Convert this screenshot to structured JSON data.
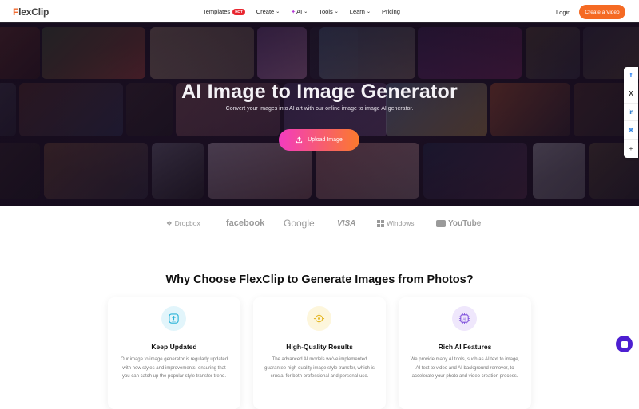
{
  "nav": {
    "logo_first": "F",
    "logo_rest": "lexClip",
    "items": [
      {
        "label": "Templates",
        "badge": "HOT"
      },
      {
        "label": "Create",
        "chevron": "⌄"
      },
      {
        "label": "AI",
        "icon": "sparkle-icon",
        "chevron": "⌄"
      },
      {
        "label": "Tools",
        "chevron": "⌄"
      },
      {
        "label": "Learn",
        "chevron": "⌄"
      },
      {
        "label": "Pricing"
      }
    ],
    "login": "Login",
    "cta": "Create a Video"
  },
  "hero": {
    "title": "AI Image to Image Generator",
    "subtitle": "Convert your images into AI art with our online image to image AI generator.",
    "upload_label": "Upload Image"
  },
  "share": [
    "f",
    "X",
    "in",
    "✉",
    "+"
  ],
  "brands": [
    "Dropbox",
    "facebook",
    "Google",
    "VISA",
    "Windows",
    "YouTube"
  ],
  "section": {
    "title": "Why Choose FlexClip to Generate Images from Photos?",
    "cards": [
      {
        "title": "Keep Updated",
        "text": "Our image to image generator is regularly updated with new styles and improvements, ensuring that you can catch up the popular style transfer trend.",
        "icon": "upload-icon",
        "color": "#2ab3d8",
        "bg": "#e2f5fb"
      },
      {
        "title": "High-Quality Results",
        "text": "The advanced AI models we've implemented guarantee high-quality image style transfer, which is crucial for both professional and personal use.",
        "icon": "target-icon",
        "color": "#e6b92a",
        "bg": "#fdf6dc"
      },
      {
        "title": "Rich AI Features",
        "text": "We provide many AI tools, such as AI text to image, AI text to video and AI background remover, to accelerate your photo and video creation process.",
        "icon": "ai-chip-icon",
        "color": "#7c4ddb",
        "bg": "#efe7fc"
      }
    ]
  }
}
